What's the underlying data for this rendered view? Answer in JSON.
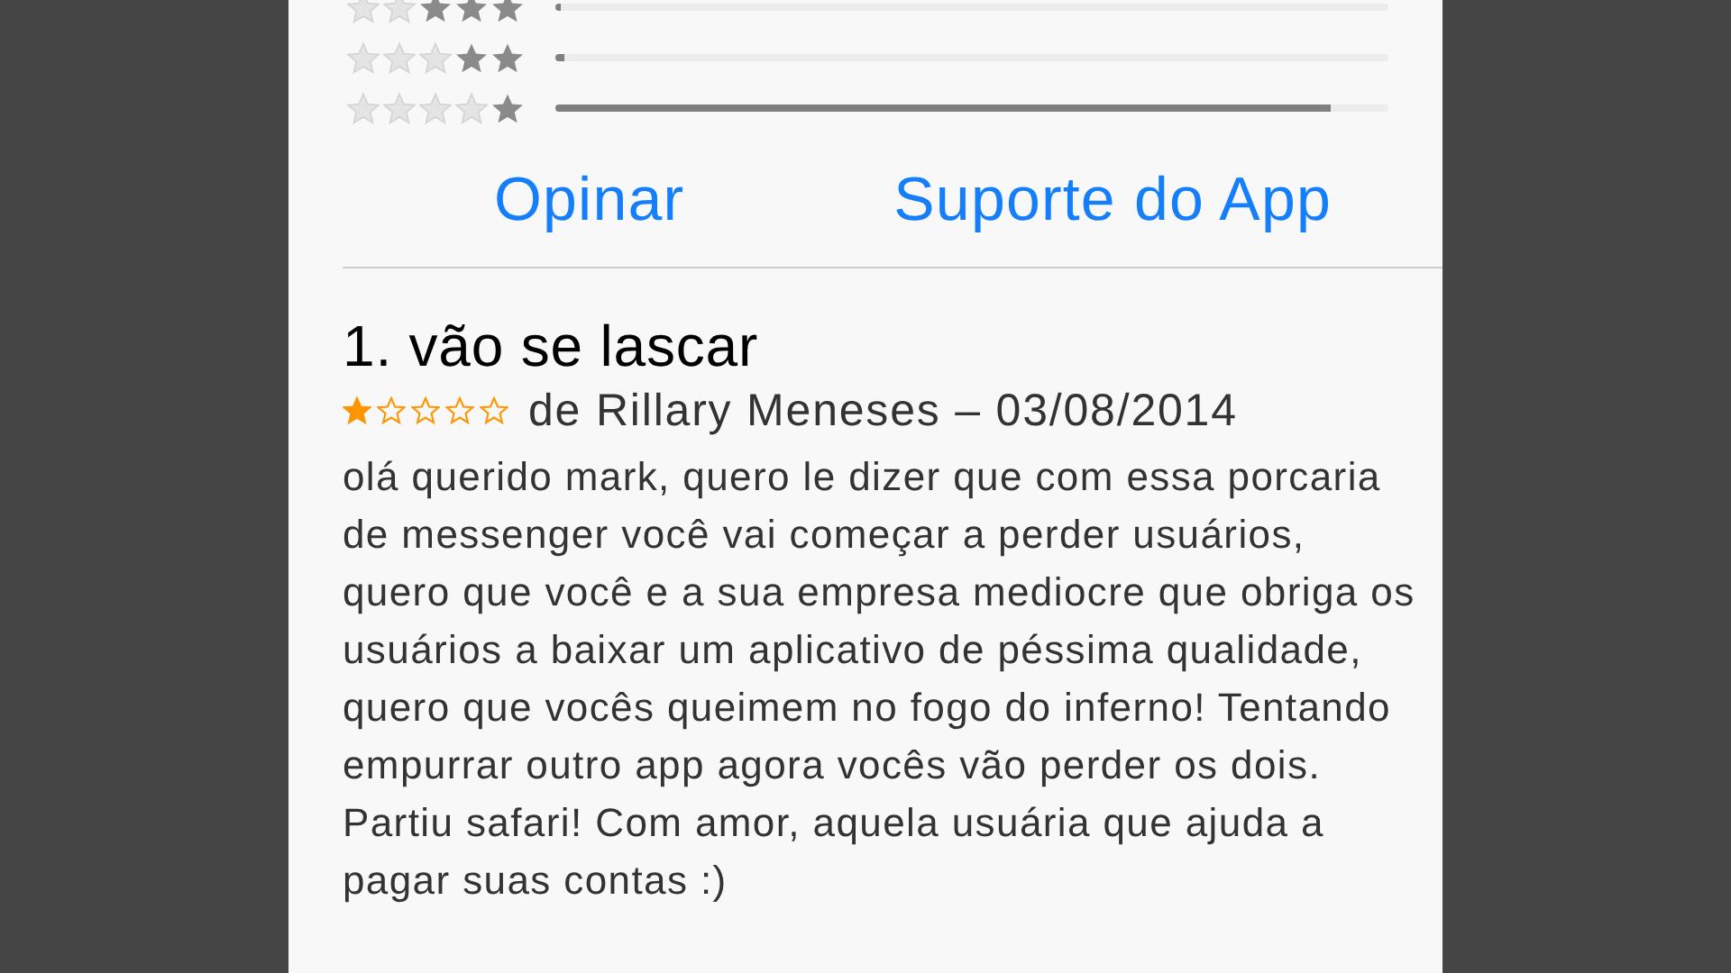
{
  "rating_breakdown": [
    {
      "stars": 3,
      "level": 0.003
    },
    {
      "stars": 2,
      "level": 0.01
    },
    {
      "stars": 1,
      "level": 0.93
    }
  ],
  "actions": [
    {
      "label": "Opinar"
    },
    {
      "label": "Suporte do App"
    }
  ],
  "reviews": [
    {
      "title": "1. vão se lascar",
      "stars": 1,
      "byline": "de Rillary Meneses – 03/08/2014",
      "body": "olá querido mark, quero le dizer que com essa porcaria de messenger você vai começar a perder usuários, quero que você e a sua empresa mediocre que obriga os usuários a baixar um aplicativo de péssima qualidade, quero que vocês queimem no fogo do inferno! Tentando empurrar outro app agora vocês vão perder os dois. Partiu safari! Com amor, aquela usuária que ajuda a pagar suas contas :)"
    }
  ]
}
